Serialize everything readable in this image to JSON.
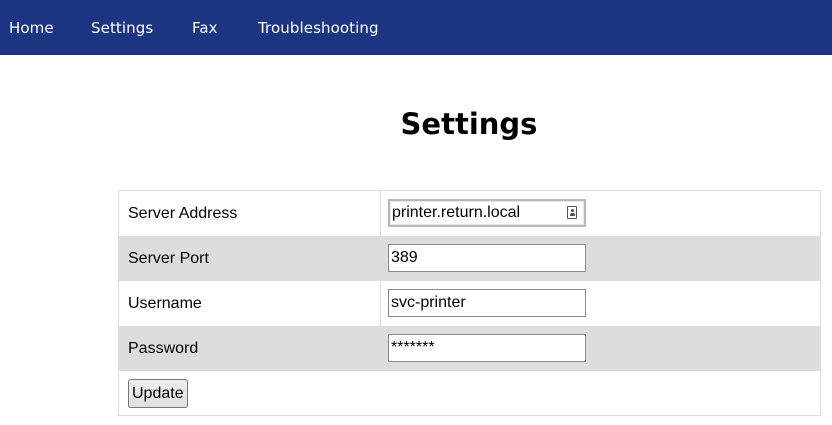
{
  "nav": {
    "items": [
      "Home",
      "Settings",
      "Fax",
      "Troubleshooting"
    ]
  },
  "page": {
    "title": "Settings"
  },
  "form": {
    "fields": [
      {
        "label": "Server Address",
        "value": "printer.return.local",
        "type": "text"
      },
      {
        "label": "Server Port",
        "value": "389",
        "type": "text"
      },
      {
        "label": "Username",
        "value": "svc-printer",
        "type": "text"
      },
      {
        "label": "Password",
        "value": "*******",
        "type": "text"
      }
    ],
    "submit_label": "Update"
  },
  "colors": {
    "navbar": "#1b3583",
    "row_alt": "#dddddd"
  },
  "icons": {
    "autofill": "contact-card-icon"
  }
}
